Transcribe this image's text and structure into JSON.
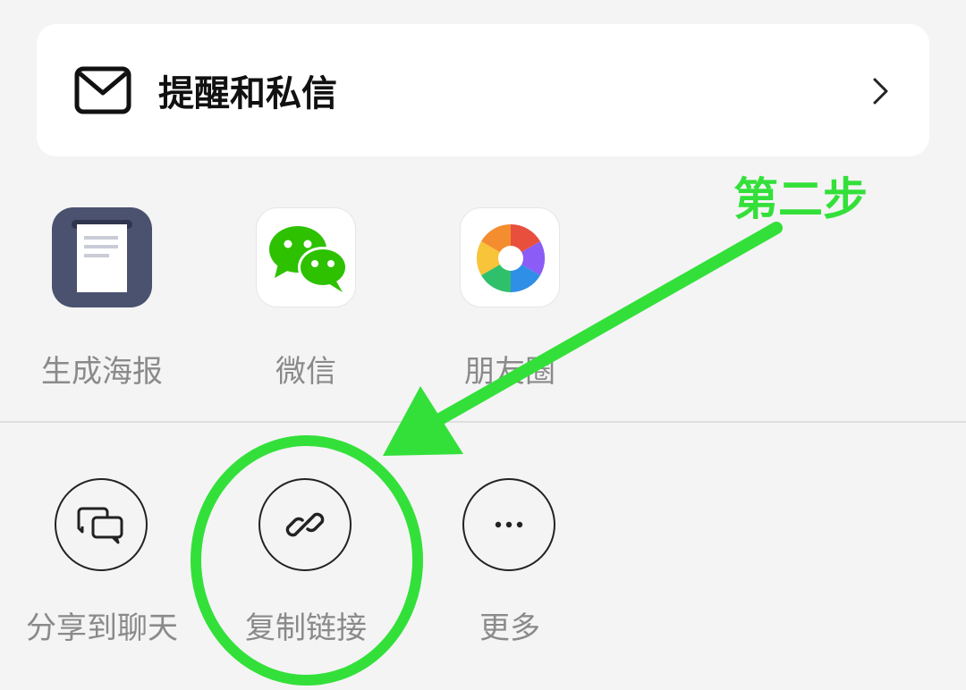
{
  "notifications_row": {
    "label": "提醒和私信",
    "icon": "mail-icon",
    "chevron": "chevron-right-icon"
  },
  "share_apps": [
    {
      "label": "生成海报",
      "icon": "poster-icon",
      "tile_color": "#4a5270"
    },
    {
      "label": "微信",
      "icon": "wechat-icon",
      "tile_color": "#ffffff"
    },
    {
      "label": "朋友圈",
      "icon": "moments-icon",
      "tile_color": "#ffffff"
    }
  ],
  "actions": [
    {
      "label": "分享到聊天",
      "icon": "chat-bubbles-icon"
    },
    {
      "label": "复制链接",
      "icon": "link-icon"
    },
    {
      "label": "更多",
      "icon": "more-dots-icon"
    }
  ],
  "annotation": {
    "text": "第二步",
    "color": "#33e03a"
  }
}
